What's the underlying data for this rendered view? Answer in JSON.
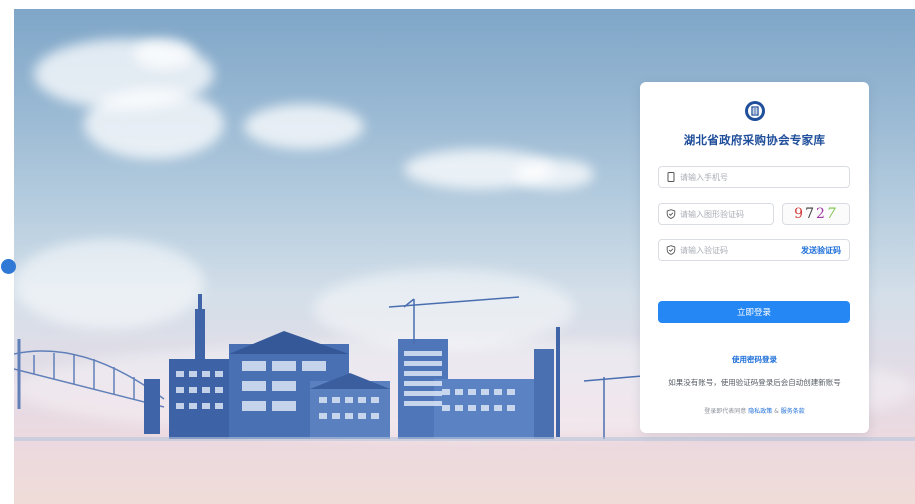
{
  "brand": {
    "title": "湖北省政府采购协会专家库"
  },
  "form": {
    "phone_placeholder": "请输入手机号",
    "captcha_placeholder": "请输入图形验证码",
    "captcha_chars": [
      "9",
      "7",
      "2",
      "7"
    ],
    "sms_placeholder": "请输入验证码",
    "send_code_label": "发送验证码",
    "login_label": "立即登录"
  },
  "alt_login": {
    "password_login_label": "使用密码登录"
  },
  "note": {
    "text": "如果没有账号，使用验证码登录后会自动创建新账号"
  },
  "agreement": {
    "prefix": "登录即代表同意",
    "privacy_label": "隐私政策",
    "and": "&",
    "terms_label": "服务条款"
  },
  "colors": {
    "primary": "#2487f3",
    "link": "#1e6fd9",
    "title": "#1f4e9a"
  },
  "icons": {
    "phone": "mobile-icon",
    "shield": "shield-check-icon",
    "logo": "association-logo-icon"
  }
}
